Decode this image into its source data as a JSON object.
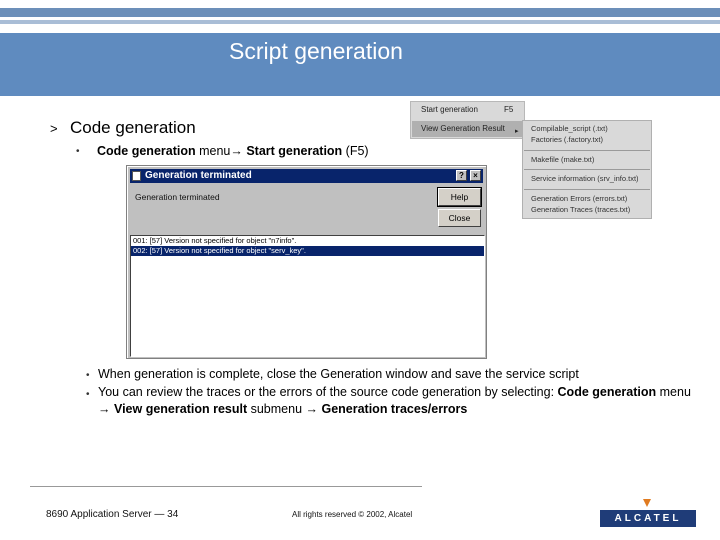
{
  "slide": {
    "title": "Script generation",
    "section_marker": ">",
    "section_heading": "Code generation"
  },
  "bullets": {
    "marker": "•",
    "b1": {
      "part1": "Code generation",
      "part2": " menu",
      "arrow": "→",
      "part3": " Start generation",
      "part4": " (F5)"
    },
    "b2": "When generation is complete, close the Generation window and save the service script",
    "b3": {
      "t1": "You can review the traces or the errors of the source code generation by selecting: ",
      "t2": "Code generation",
      "t3": " menu ",
      "arrow": "→",
      "t4": " View generation result",
      "t5": " submenu ",
      "t6": " Generation traces/errors"
    }
  },
  "dialog": {
    "title": "Generation terminated",
    "message": "Generation terminated",
    "btn_help": "Help",
    "btn_close": "Close",
    "ctrl_help": "?",
    "ctrl_close": "×",
    "rows": [
      "001: [57] Version not specified for object \"n7info\".",
      "002: [57] Version not specified for object \"serv_key\"."
    ]
  },
  "menu_main": {
    "item1": "Start generation",
    "item1_shortcut": "F5",
    "item2": "View Generation Result",
    "submenu_arrow": "▸"
  },
  "menu_sub": {
    "i1": "Compilable_script (.txt)",
    "i2": "Factories (.factory.txt)",
    "i3": "Makefile (make.txt)",
    "i4": "Service information (srv_info.txt)",
    "i5": "Generation Errors (errors.txt)",
    "i6": "Generation Traces (traces.txt)"
  },
  "footer": {
    "left": "8690 Application Server — 34",
    "middle": "All rights reserved © 2002, Alcatel",
    "logo": "ALCATEL"
  }
}
